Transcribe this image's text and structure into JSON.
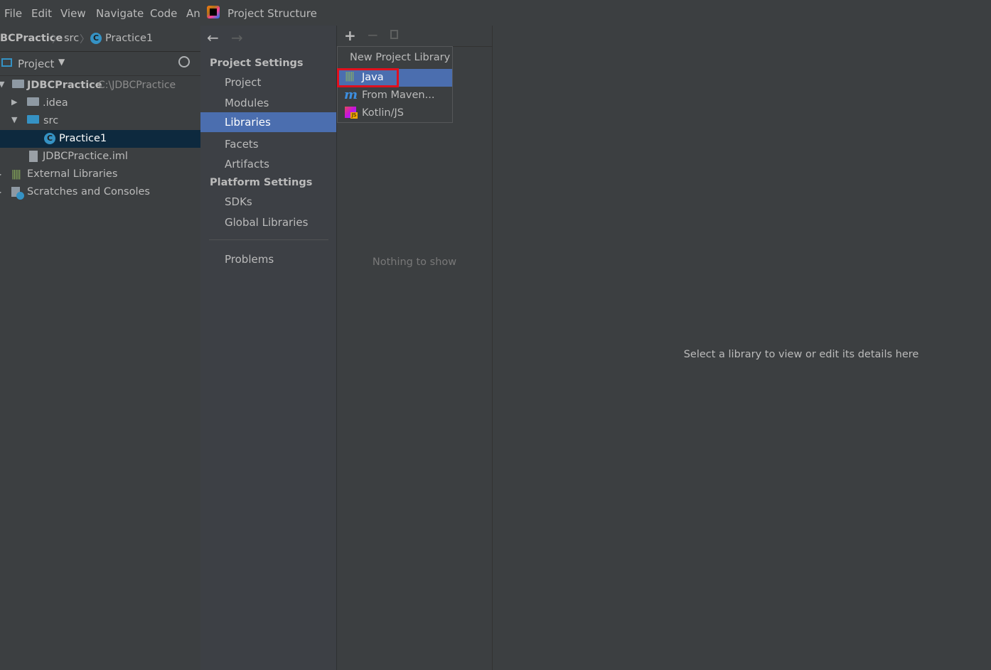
{
  "ide": {
    "menu": [
      "File",
      "Edit",
      "View",
      "Navigate",
      "Code",
      "An"
    ],
    "breadcrumb": {
      "project": "BCPractice",
      "src": "src",
      "file": "Practice1"
    },
    "tool_window": {
      "title": "Project"
    },
    "tree": [
      {
        "label": "JDBCPractice",
        "path": "C:\\JDBCPractice"
      },
      {
        "label": ".idea"
      },
      {
        "label": "src"
      },
      {
        "label": "Practice1"
      },
      {
        "label": "JDBCPractice.iml"
      },
      {
        "label": "External Libraries"
      },
      {
        "label": "Scratches and Consoles"
      }
    ]
  },
  "dialog": {
    "title": "Project Structure",
    "project_settings_header": "Project Settings",
    "project_settings": [
      "Project",
      "Modules",
      "Libraries",
      "Facets",
      "Artifacts"
    ],
    "platform_settings_header": "Platform Settings",
    "platform_settings": [
      "SDKs",
      "Global Libraries"
    ],
    "problems": "Problems",
    "active_item": "Libraries",
    "list_empty_text": "Nothing to show",
    "detail_text": "Select a library to view or edit its details here"
  },
  "popup": {
    "header": "New Project Library",
    "items": [
      "Java",
      "From Maven...",
      "Kotlin/JS"
    ]
  },
  "colors": {
    "selection": "#4b6eaf",
    "highlight": "#e0101e",
    "background": "#3c3f41"
  }
}
